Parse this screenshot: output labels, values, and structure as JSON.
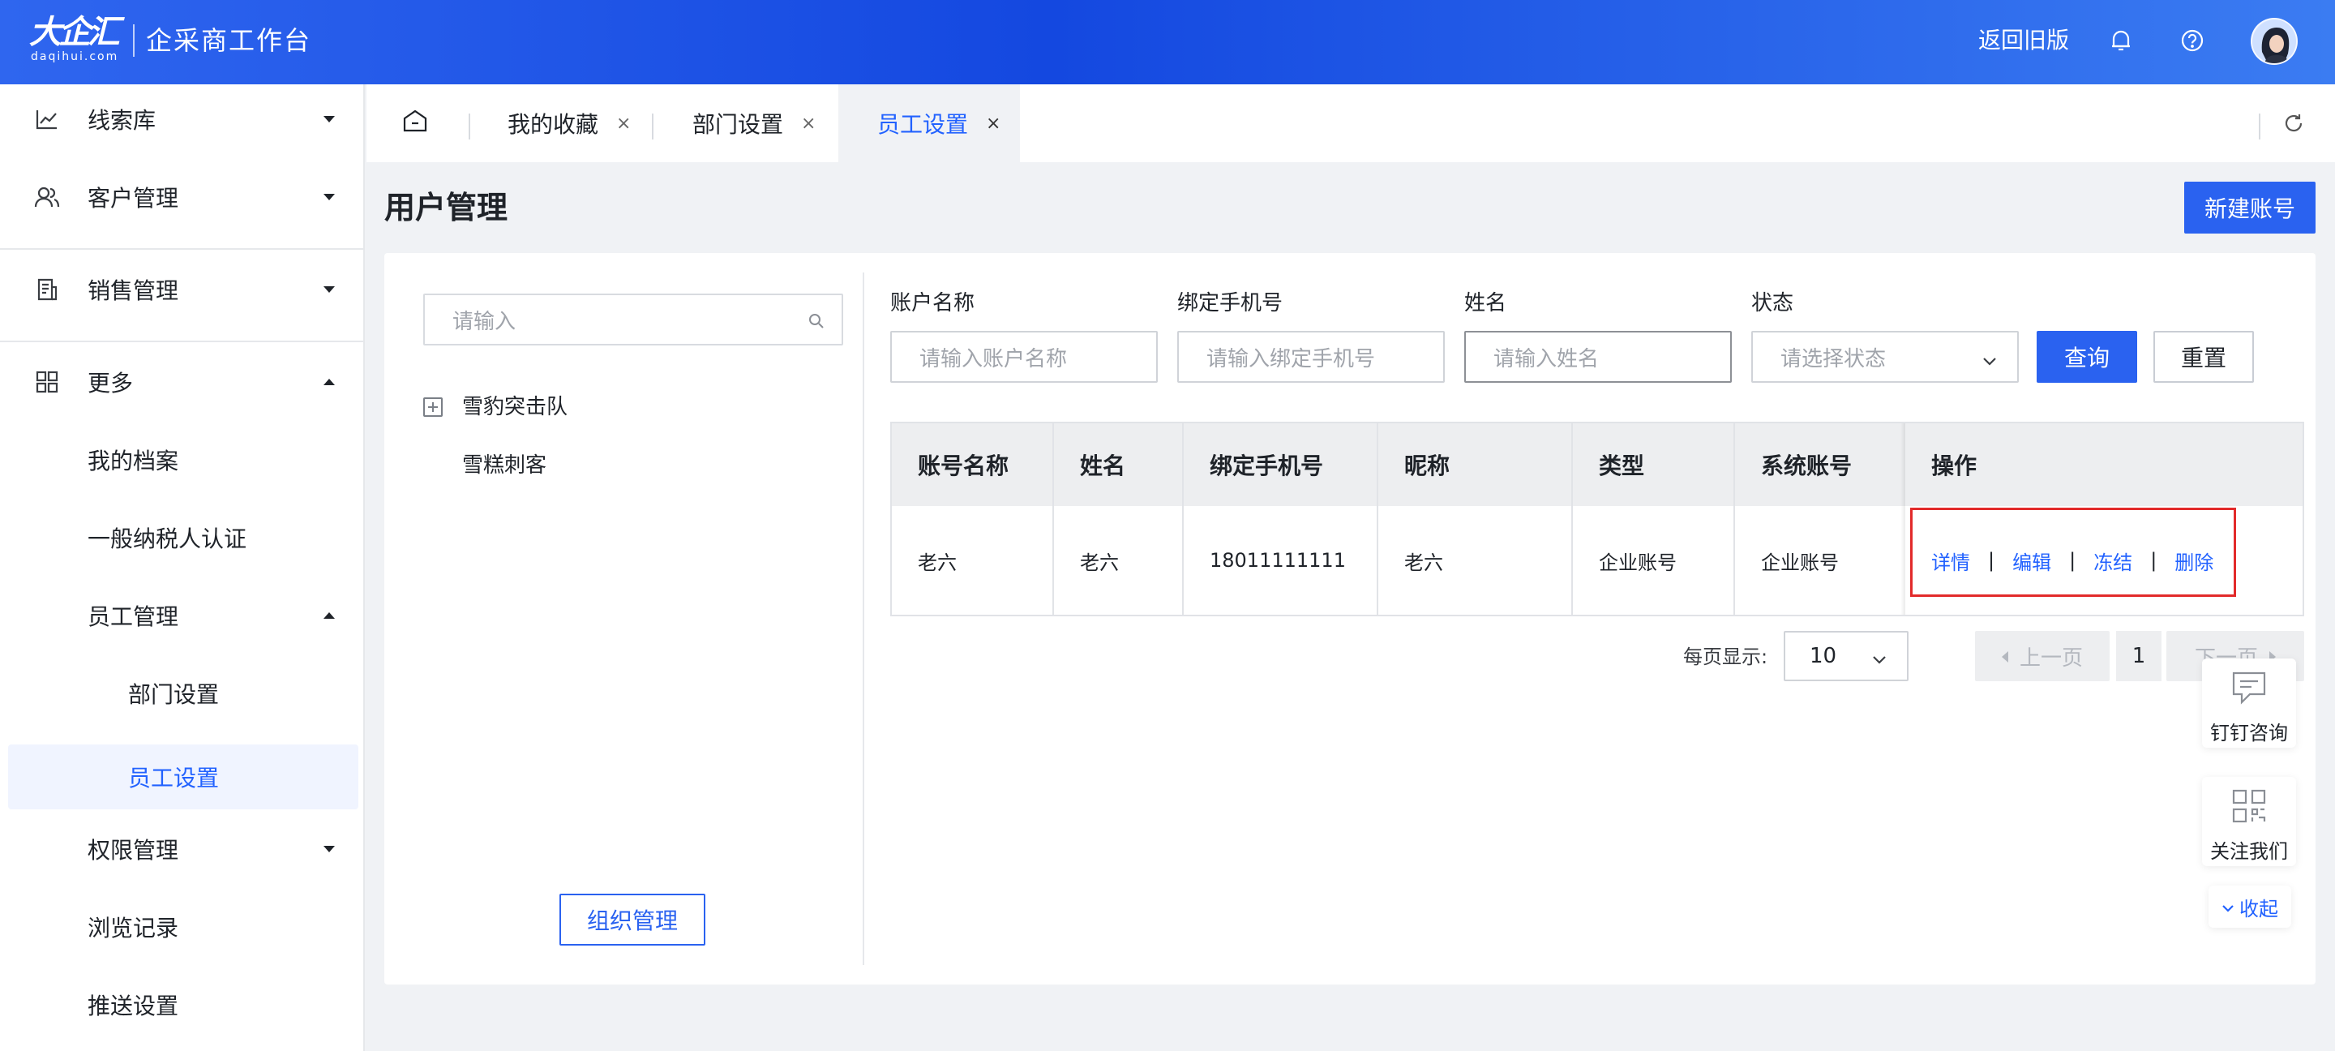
{
  "colors": {
    "primary": "#2a62f0",
    "link": "#2262ff",
    "highlight": "#e22a2a",
    "header_gradient": [
      "#2f66ef",
      "#1448e0",
      "#3b7cf2"
    ]
  },
  "header": {
    "logo_main": "大企汇",
    "logo_sub": "daqihui.com",
    "app_title": "企采商工作台",
    "back_old": "返回旧版",
    "icons": [
      "bell-icon",
      "help-icon",
      "avatar"
    ]
  },
  "sidebar": {
    "items": [
      {
        "label": "线索库",
        "icon": "chart-icon",
        "caret": "down"
      },
      {
        "label": "客户管理",
        "icon": "users-icon",
        "caret": "down"
      },
      {
        "label": "销售管理",
        "icon": "document-icon",
        "caret": "down"
      },
      {
        "label": "更多",
        "icon": "grid-icon",
        "caret": "up"
      },
      {
        "label": "我的档案"
      },
      {
        "label": "一般纳税人认证"
      },
      {
        "label": "员工管理",
        "caret": "up"
      },
      {
        "label": "部门设置"
      },
      {
        "label": "员工设置",
        "active": true
      },
      {
        "label": "权限管理",
        "caret": "down"
      },
      {
        "label": "浏览记录"
      },
      {
        "label": "推送设置"
      }
    ]
  },
  "tabs": [
    {
      "label": "我的收藏",
      "close": "×"
    },
    {
      "label": "部门设置",
      "close": "×"
    },
    {
      "label": "员工设置",
      "close": "×",
      "active": true
    }
  ],
  "page": {
    "title": "用户管理",
    "new_account": "新建账号"
  },
  "tree": {
    "search_placeholder": "请输入",
    "nodes": [
      "雪豹突击队",
      "雪糕刺客"
    ],
    "org_button": "组织管理"
  },
  "filters": {
    "account_name": {
      "label": "账户名称",
      "placeholder": "请输入账户名称"
    },
    "phone": {
      "label": "绑定手机号",
      "placeholder": "请输入绑定手机号"
    },
    "name": {
      "label": "姓名",
      "placeholder": "请输入姓名"
    },
    "status": {
      "label": "状态",
      "placeholder": "请选择状态"
    },
    "query": "查询",
    "reset": "重置"
  },
  "table": {
    "headers": [
      "账号名称",
      "姓名",
      "绑定手机号",
      "昵称",
      "类型",
      "系统账号",
      "操作"
    ],
    "rows": [
      {
        "cells": [
          "老六",
          "老六",
          "18011111111",
          "老六",
          "企业账号",
          "企业账号"
        ],
        "actions": [
          "详情",
          "编辑",
          "冻结",
          "删除"
        ]
      }
    ],
    "action_sep": "|"
  },
  "pagination": {
    "page_size_label": "每页显示:",
    "page_size": "10",
    "prev": "上一页",
    "current": "1",
    "next": "下一页"
  },
  "float_widget": {
    "consult": "钉钉咨询",
    "follow": "关注我们",
    "collapse": "收起"
  }
}
